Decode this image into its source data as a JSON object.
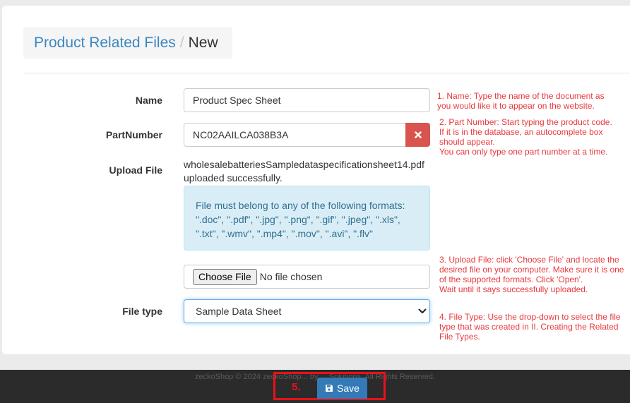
{
  "breadcrumb": {
    "parent": "Product Related Files",
    "separator": "/",
    "current": "New"
  },
  "form": {
    "name_label": "Name",
    "name_value": "Product Spec Sheet",
    "partnumber_label": "PartNumber",
    "partnumber_value": "NC02AAILCA038B3A",
    "upload_label": "Upload File",
    "upload_filename": "wholesalebatteriesSampledataspecificationsheet14.pdf",
    "upload_status": "uploaded successfully.",
    "formats_intro": "File must belong to any of the following formats:",
    "formats_list": "\".doc\", \".pdf\", \".jpg\", \".png\", \".gif\", \".jpeg\", \".xls\", \".txt\", \".wmv\", \".mp4\", \".mov\", \".avi\", \".flv\"",
    "choose_file_label": "Choose File",
    "no_file_label": "No file chosen",
    "filetype_label": "File type",
    "filetype_value": "Sample Data Sheet"
  },
  "help": {
    "step1": "1. Name: Type the name of the document as you would like it to appear on the website.",
    "step2a": "2. Part Number: Start typing the product code.",
    "step2b": "If it is in the database, an autocomplete box should appear.",
    "step2c": "You can only type one part number at a time.",
    "step3a": "3. Upload File: click 'Choose File' and locate the desired file on your computer. Make sure it is one of the supported formats. Click 'Open'.",
    "step3b": "Wait until it says successfully uploaded.",
    "step4": "4. File Type: Use the drop-down to select the file type that was created in II. Creating the Related File Types."
  },
  "footer": {
    "copyright": "zeckoShop © 2024 zeckoShop... by ... Solutions. All Rights Reserved.",
    "step_number": "5.",
    "save_label": "Save"
  },
  "colors": {
    "accent": "#337ab7",
    "danger": "#d9534f",
    "annotation": "#e8383d"
  }
}
